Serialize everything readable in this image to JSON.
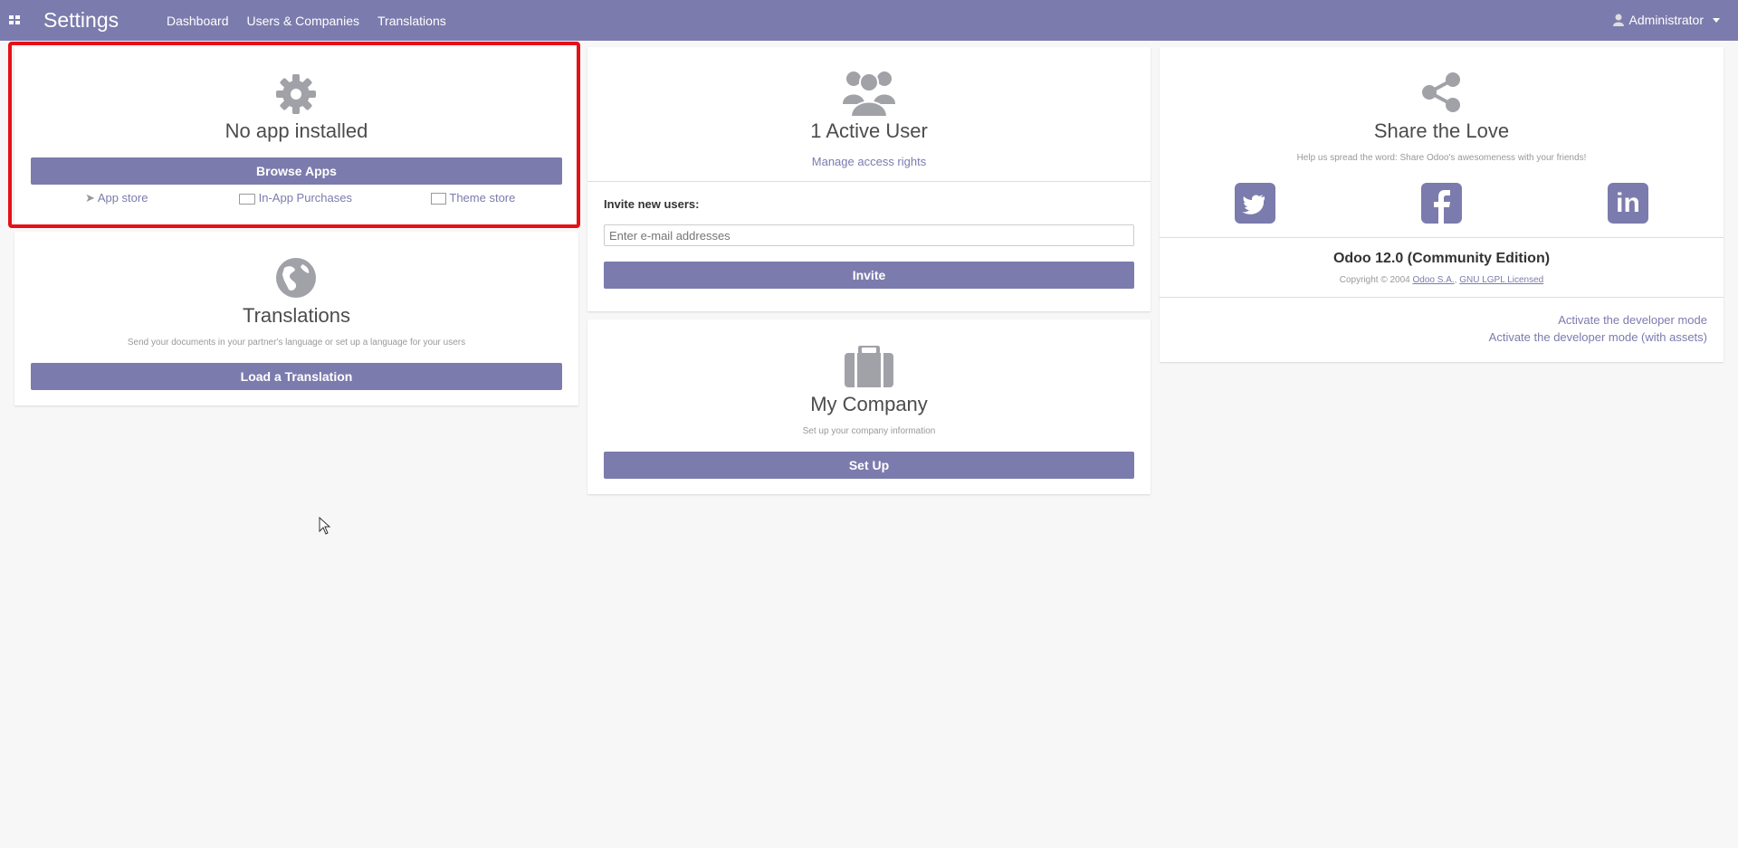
{
  "navbar": {
    "brand": "Settings",
    "menu": [
      "Dashboard",
      "Users & Companies",
      "Translations"
    ],
    "user": "Administrator"
  },
  "apps": {
    "title": "No app installed",
    "browse_button": "Browse Apps",
    "links": [
      "App store",
      "In-App Purchases",
      "Theme store"
    ]
  },
  "translations": {
    "title": "Translations",
    "description": "Send your documents in your partner's language or set up a language for your users",
    "button": "Load a Translation"
  },
  "users": {
    "title": "1 Active User",
    "manage_link": "Manage access rights",
    "invite_label": "Invite new users:",
    "invite_placeholder": "Enter e-mail addresses",
    "invite_button": "Invite"
  },
  "company": {
    "title": "My Company",
    "description": "Set up your company information",
    "button": "Set Up"
  },
  "share": {
    "title": "Share the Love",
    "description": "Help us spread the word: Share Odoo's awesomeness with your friends!"
  },
  "version": {
    "title": "Odoo 12.0 (Community Edition)",
    "copyright": "Copyright © 2004",
    "company_link": "Odoo S.A.",
    "license_link": "GNU LGPL Licensed"
  },
  "developer": {
    "mode": "Activate the developer mode",
    "mode_assets": "Activate the developer mode (with assets)"
  },
  "colors": {
    "accent": "#7c7bad",
    "highlight": "#e41117"
  }
}
